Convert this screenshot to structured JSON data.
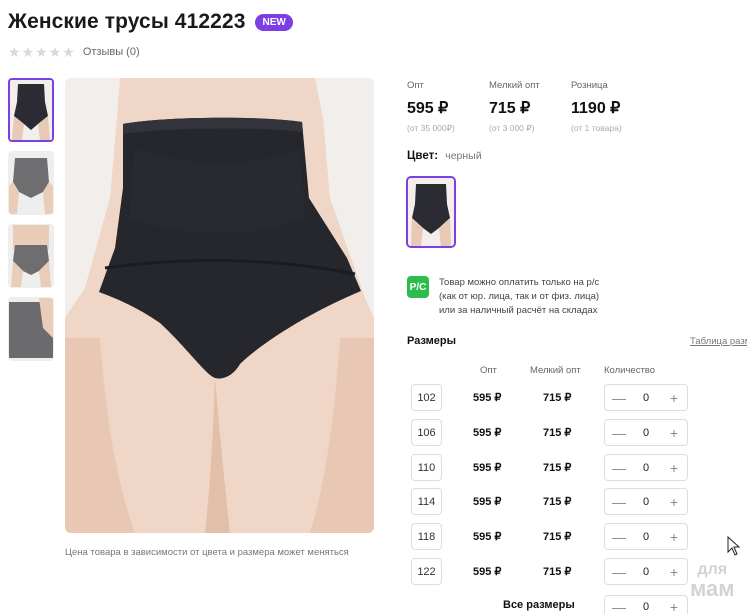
{
  "product": {
    "title": "Женские трусы 412223",
    "badge": "NEW",
    "reviews": "Отзывы (0)",
    "rating_stars": 0
  },
  "gallery": {
    "caption": "Цена товара в зависимости от цвета и размера может меняться"
  },
  "prices": [
    {
      "label": "Опт",
      "value": "595 ₽",
      "note": "(от 35 000₽)"
    },
    {
      "label": "Мелкий опт",
      "value": "715 ₽",
      "note": "(от 3 000 ₽)"
    },
    {
      "label": "Розница",
      "value": "1190 ₽",
      "note": "(от 1 товара)"
    }
  ],
  "color": {
    "label": "Цвет:",
    "value": "черный"
  },
  "payment": {
    "icon_text": "Р/С",
    "line1": "Товар можно оплатить только на р/с",
    "line2": "(как от юр. лица, так и от физ. лица)",
    "line3": "или за наличный расчёт на складах"
  },
  "sizes": {
    "title": "Размеры",
    "table_link": "Таблица разм",
    "columns": {
      "opt": "Опт",
      "small": "Мелкий опт",
      "qty": "Количество"
    },
    "rows": [
      {
        "size": "102",
        "opt": "595 ₽",
        "small": "715 ₽",
        "qty": "0"
      },
      {
        "size": "106",
        "opt": "595 ₽",
        "small": "715 ₽",
        "qty": "0"
      },
      {
        "size": "110",
        "opt": "595 ₽",
        "small": "715 ₽",
        "qty": "0"
      },
      {
        "size": "114",
        "opt": "595 ₽",
        "small": "715 ₽",
        "qty": "0"
      },
      {
        "size": "118",
        "opt": "595 ₽",
        "small": "715 ₽",
        "qty": "0"
      },
      {
        "size": "122",
        "opt": "595 ₽",
        "small": "715 ₽",
        "qty": "0"
      }
    ],
    "all_label": "Все размеры",
    "all_qty": "0",
    "minus": "—",
    "plus": "+"
  },
  "watermark": {
    "line1": "для",
    "line2": "мам"
  },
  "colors": {
    "accent": "#7b3fe4",
    "payment_green": "#2dbd4e"
  }
}
